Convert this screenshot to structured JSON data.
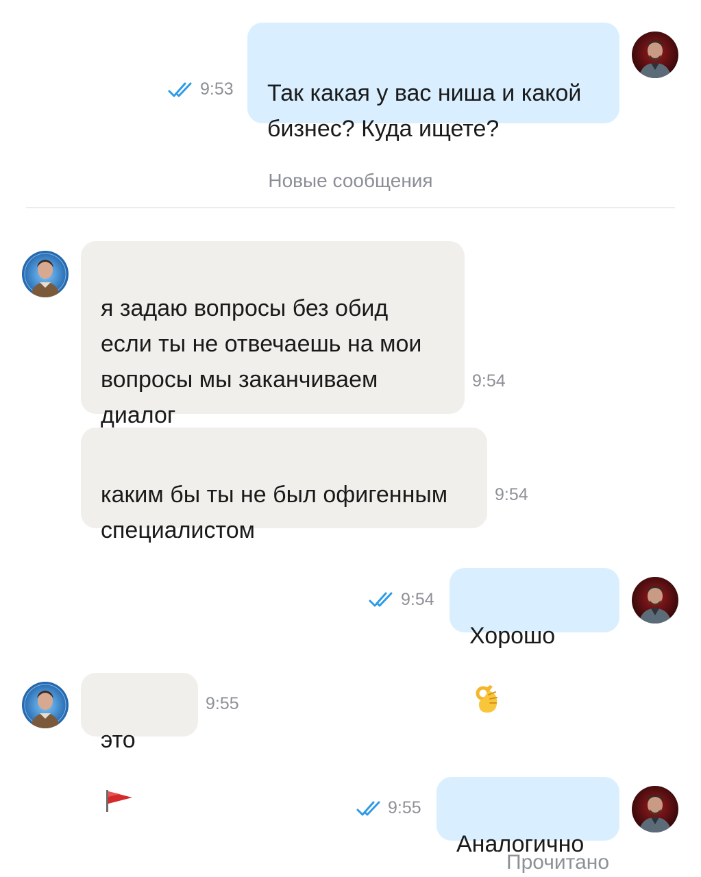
{
  "chat": {
    "messages": [
      {
        "direction": "out",
        "text": "Так какая у вас ниша и какой\nбизнес? Куда ищете?",
        "time": "9:53",
        "status": "read"
      },
      {
        "direction": "in",
        "text": "я задаю вопросы без обид\nесли ты не отвечаешь на мои\nвопросы мы заканчиваем\nдиалог",
        "time": "9:54"
      },
      {
        "direction": "in",
        "text": "каким бы ты не был офигенным\nспециалистом",
        "time": "9:54"
      },
      {
        "direction": "out",
        "text": "Хорошо",
        "emoji": "ok-hand-emoji",
        "time": "9:54",
        "status": "read"
      },
      {
        "direction": "in",
        "text": "это",
        "emoji": "red-flag-emoji",
        "time": "9:55"
      },
      {
        "direction": "out",
        "text": "Аналогично",
        "time": "9:55",
        "status": "read"
      }
    ],
    "new_messages_divider": "Новые сообщения",
    "read_status": "Прочитано"
  },
  "colors": {
    "outgoing_bubble": "#d9efff",
    "incoming_bubble": "#f1efeb",
    "read_ticks": "#2f9ae6",
    "time_text": "#8d9096"
  },
  "icons": {
    "read_receipt": "double-check-icon",
    "own_avatar": "user-avatar",
    "contact_avatar": "contact-avatar"
  }
}
